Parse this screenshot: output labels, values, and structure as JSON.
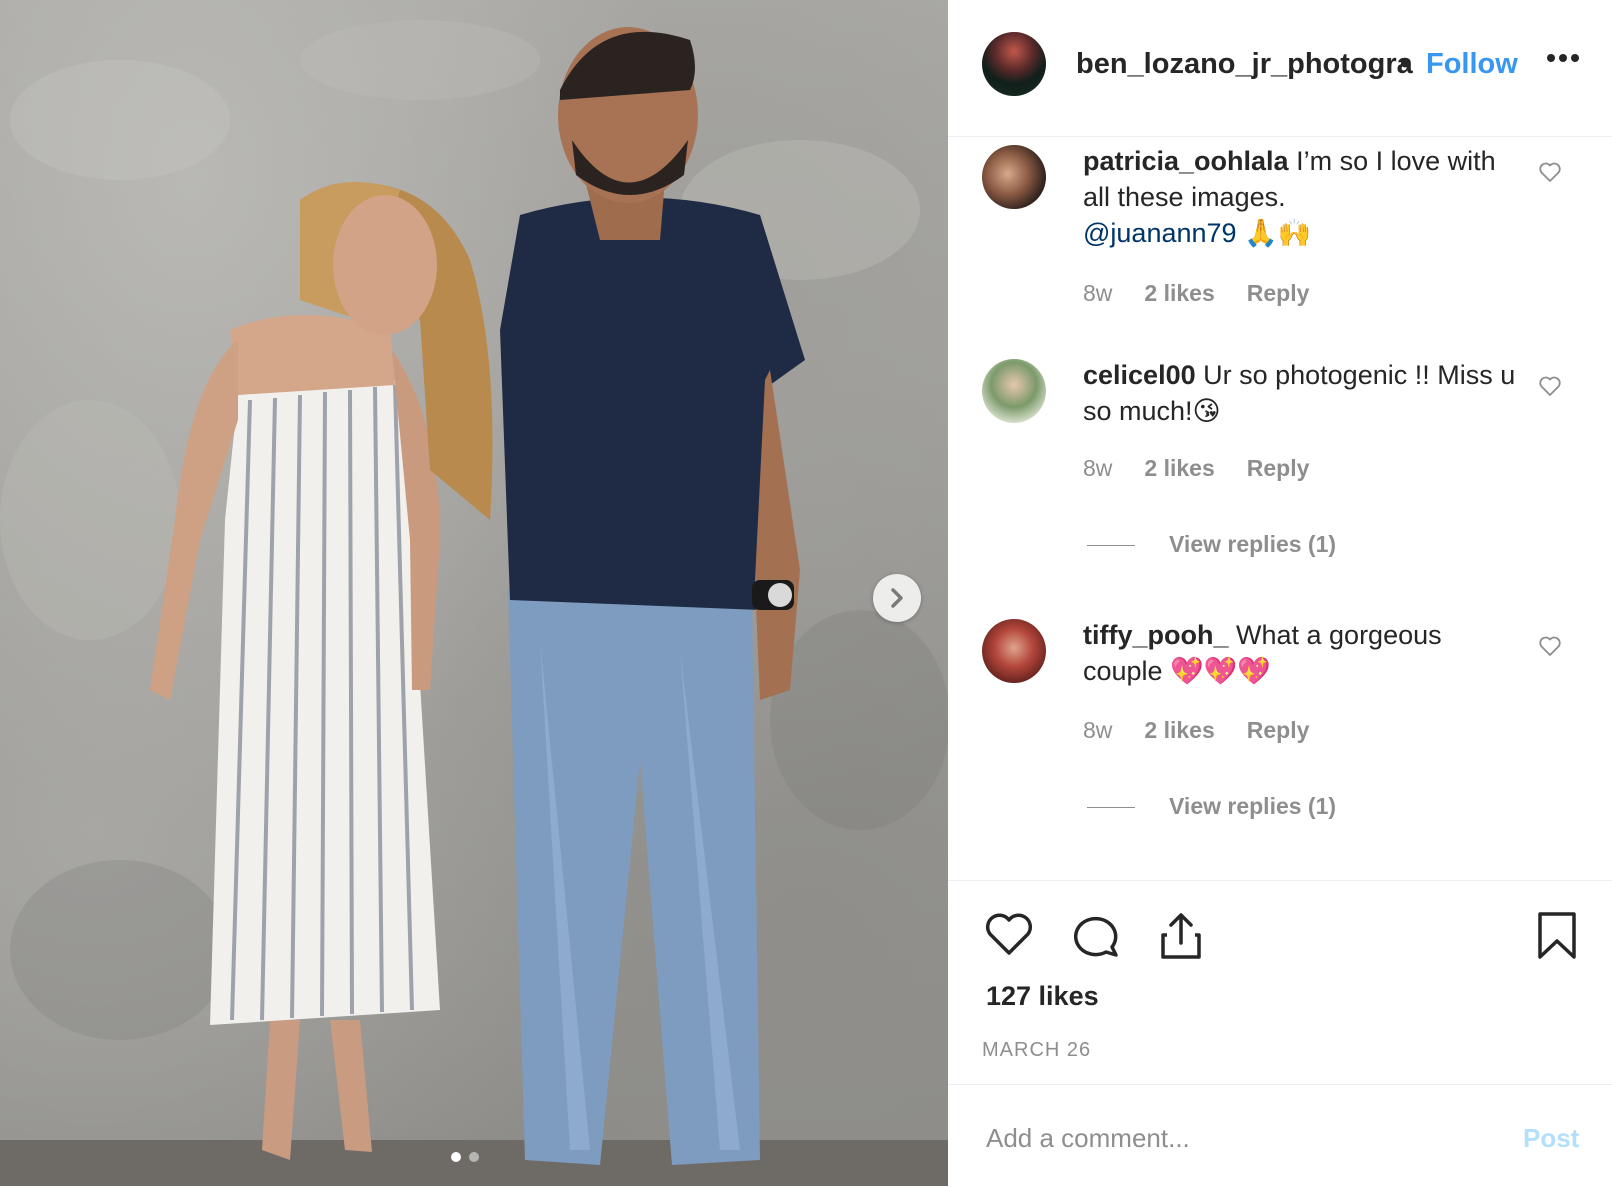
{
  "post": {
    "image_alt": "Couple posing against a concrete wall",
    "carousel_pages": 2,
    "carousel_current": 1
  },
  "header": {
    "username": "ben_lozano_jr_photogra",
    "separator": "•",
    "follow_label": "Follow",
    "more_icon": "more-horizontal-icon"
  },
  "comments": [
    {
      "username": "patricia_oohlala",
      "text": " I’m so I love with all these images.",
      "mention": "@juanann79",
      "emoji": " 🙏🙌",
      "time": "8w",
      "likes": "2 likes",
      "reply_label": "Reply"
    },
    {
      "username": "celicel00",
      "text": " Ur so photogenic !! Miss u so much!😘",
      "time": "8w",
      "likes": "2 likes",
      "reply_label": "Reply",
      "view_replies": "View replies (1)"
    },
    {
      "username": "tiffy_pooh_",
      "text": " What a gorgeous couple 💖💖💖",
      "time": "8w",
      "likes": "2 likes",
      "reply_label": "Reply",
      "view_replies": "View replies (1)"
    }
  ],
  "actions": {
    "like_icon": "heart-icon",
    "comment_icon": "comment-icon",
    "share_icon": "share-icon",
    "save_icon": "bookmark-icon",
    "likes_count": "127 likes",
    "date": "MARCH 26"
  },
  "add_comment": {
    "placeholder": "Add a comment...",
    "post_label": "Post"
  },
  "colors": {
    "link_blue": "#3897f0",
    "mention_blue": "#003569",
    "muted_text": "#8e8e8e",
    "post_disabled": "#b2dffc",
    "border": "#efefef"
  }
}
